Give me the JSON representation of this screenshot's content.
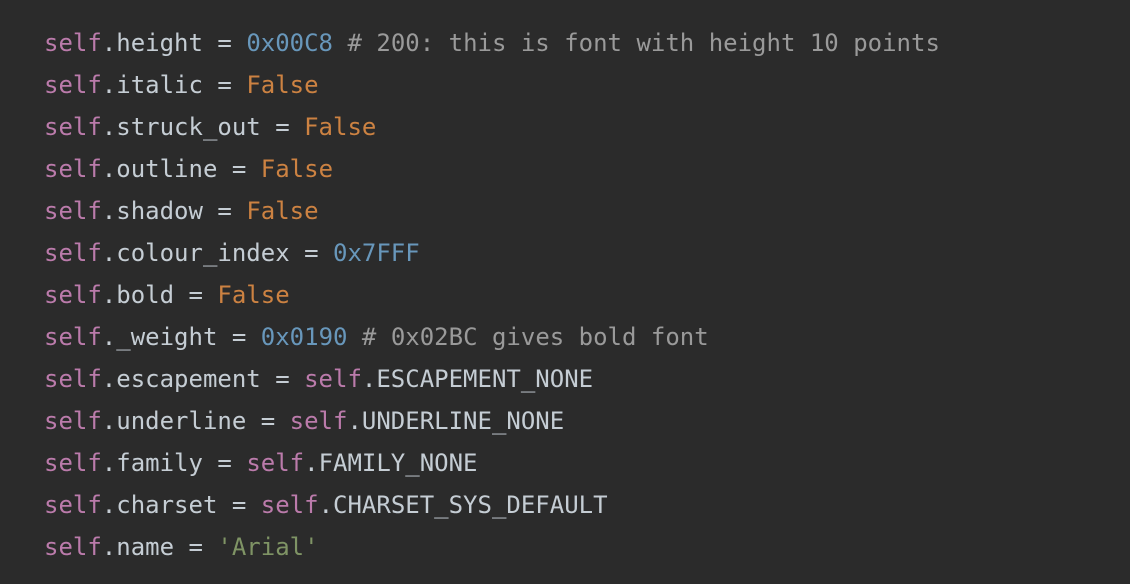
{
  "editor": {
    "background_color": "#2b2b2b",
    "language": "python",
    "palette": {
      "self_keyword": "#bb7bab",
      "attribute": "#c5cdd4",
      "operator": "#c5cdd4",
      "number": "#6897bb",
      "boolean_keyword": "#cc8242",
      "comment": "#9a9a9a",
      "string": "#7f9465",
      "constant": "#c5cdd4"
    },
    "lines": [
      {
        "id": "line-height",
        "text": "self.height = 0x00C8 # 200: this is font with height 10 points",
        "tokens": [
          {
            "t": "self",
            "c": "t-self"
          },
          {
            "t": ".",
            "c": "t-punct"
          },
          {
            "t": "height",
            "c": "t-attr"
          },
          {
            "t": " = ",
            "c": "t-op"
          },
          {
            "t": "0x00C8",
            "c": "t-number"
          },
          {
            "t": " ",
            "c": "t-op"
          },
          {
            "t": "# 200: this is font with height 10 points",
            "c": "t-comment"
          }
        ]
      },
      {
        "id": "line-italic",
        "text": "self.italic = False",
        "tokens": [
          {
            "t": "self",
            "c": "t-self"
          },
          {
            "t": ".",
            "c": "t-punct"
          },
          {
            "t": "italic",
            "c": "t-attr"
          },
          {
            "t": " = ",
            "c": "t-op"
          },
          {
            "t": "False",
            "c": "t-keyword"
          }
        ]
      },
      {
        "id": "line-struck-out",
        "text": "self.struck_out = False",
        "tokens": [
          {
            "t": "self",
            "c": "t-self"
          },
          {
            "t": ".",
            "c": "t-punct"
          },
          {
            "t": "struck_out",
            "c": "t-attr"
          },
          {
            "t": " = ",
            "c": "t-op"
          },
          {
            "t": "False",
            "c": "t-keyword"
          }
        ]
      },
      {
        "id": "line-outline",
        "text": "self.outline = False",
        "tokens": [
          {
            "t": "self",
            "c": "t-self"
          },
          {
            "t": ".",
            "c": "t-punct"
          },
          {
            "t": "outline",
            "c": "t-attr"
          },
          {
            "t": " = ",
            "c": "t-op"
          },
          {
            "t": "False",
            "c": "t-keyword"
          }
        ]
      },
      {
        "id": "line-shadow",
        "text": "self.shadow = False",
        "tokens": [
          {
            "t": "self",
            "c": "t-self"
          },
          {
            "t": ".",
            "c": "t-punct"
          },
          {
            "t": "shadow",
            "c": "t-attr"
          },
          {
            "t": " = ",
            "c": "t-op"
          },
          {
            "t": "False",
            "c": "t-keyword"
          }
        ]
      },
      {
        "id": "line-colour-index",
        "text": "self.colour_index = 0x7FFF",
        "tokens": [
          {
            "t": "self",
            "c": "t-self"
          },
          {
            "t": ".",
            "c": "t-punct"
          },
          {
            "t": "colour_index",
            "c": "t-attr"
          },
          {
            "t": " = ",
            "c": "t-op"
          },
          {
            "t": "0x7FFF",
            "c": "t-number"
          }
        ]
      },
      {
        "id": "line-bold",
        "text": "self.bold = False",
        "tokens": [
          {
            "t": "self",
            "c": "t-self"
          },
          {
            "t": ".",
            "c": "t-punct"
          },
          {
            "t": "bold",
            "c": "t-attr"
          },
          {
            "t": " = ",
            "c": "t-op"
          },
          {
            "t": "False",
            "c": "t-keyword"
          }
        ]
      },
      {
        "id": "line-weight",
        "text": "self._weight = 0x0190 # 0x02BC gives bold font",
        "tokens": [
          {
            "t": "self",
            "c": "t-self"
          },
          {
            "t": ".",
            "c": "t-punct"
          },
          {
            "t": "_weight",
            "c": "t-attr"
          },
          {
            "t": " = ",
            "c": "t-op"
          },
          {
            "t": "0x0190",
            "c": "t-number"
          },
          {
            "t": " ",
            "c": "t-op"
          },
          {
            "t": "# 0x02BC gives bold font",
            "c": "t-comment"
          }
        ]
      },
      {
        "id": "line-escapement",
        "text": "self.escapement = self.ESCAPEMENT_NONE",
        "tokens": [
          {
            "t": "self",
            "c": "t-self"
          },
          {
            "t": ".",
            "c": "t-punct"
          },
          {
            "t": "escapement",
            "c": "t-attr"
          },
          {
            "t": " = ",
            "c": "t-op"
          },
          {
            "t": "self",
            "c": "t-self"
          },
          {
            "t": ".",
            "c": "t-punct"
          },
          {
            "t": "ESCAPEMENT_NONE",
            "c": "t-const"
          }
        ]
      },
      {
        "id": "line-underline",
        "text": "self.underline = self.UNDERLINE_NONE",
        "tokens": [
          {
            "t": "self",
            "c": "t-self"
          },
          {
            "t": ".",
            "c": "t-punct"
          },
          {
            "t": "underline",
            "c": "t-attr"
          },
          {
            "t": " = ",
            "c": "t-op"
          },
          {
            "t": "self",
            "c": "t-self"
          },
          {
            "t": ".",
            "c": "t-punct"
          },
          {
            "t": "UNDERLINE_NONE",
            "c": "t-const"
          }
        ]
      },
      {
        "id": "line-family",
        "text": "self.family = self.FAMILY_NONE",
        "tokens": [
          {
            "t": "self",
            "c": "t-self"
          },
          {
            "t": ".",
            "c": "t-punct"
          },
          {
            "t": "family",
            "c": "t-attr"
          },
          {
            "t": " = ",
            "c": "t-op"
          },
          {
            "t": "self",
            "c": "t-self"
          },
          {
            "t": ".",
            "c": "t-punct"
          },
          {
            "t": "FAMILY_NONE",
            "c": "t-const"
          }
        ]
      },
      {
        "id": "line-charset",
        "text": "self.charset = self.CHARSET_SYS_DEFAULT",
        "tokens": [
          {
            "t": "self",
            "c": "t-self"
          },
          {
            "t": ".",
            "c": "t-punct"
          },
          {
            "t": "charset",
            "c": "t-attr"
          },
          {
            "t": " = ",
            "c": "t-op"
          },
          {
            "t": "self",
            "c": "t-self"
          },
          {
            "t": ".",
            "c": "t-punct"
          },
          {
            "t": "CHARSET_SYS_DEFAULT",
            "c": "t-const"
          }
        ]
      },
      {
        "id": "line-name",
        "text": "self.name = 'Arial'",
        "tokens": [
          {
            "t": "self",
            "c": "t-self"
          },
          {
            "t": ".",
            "c": "t-punct"
          },
          {
            "t": "name",
            "c": "t-attr"
          },
          {
            "t": " = ",
            "c": "t-op"
          },
          {
            "t": "'Arial'",
            "c": "t-string"
          }
        ]
      }
    ]
  }
}
